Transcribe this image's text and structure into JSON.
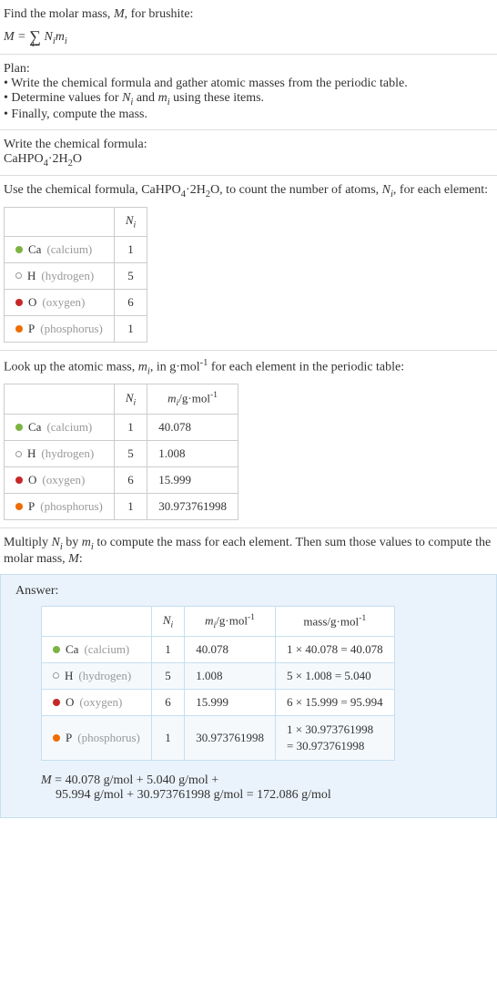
{
  "intro": {
    "line1_pre": "Find the molar mass, ",
    "line1_var": "M",
    "line1_post": ", for brushite:",
    "formula_html": "M = ∑ N<sub>i</sub>m<sub>i</sub>",
    "formula_sub": "i"
  },
  "plan": {
    "heading": "Plan:",
    "b1": "• Write the chemical formula and gather atomic masses from the periodic table.",
    "b2_pre": "• Determine values for ",
    "b2_n": "N",
    "b2_mid": " and ",
    "b2_m": "m",
    "b2_post": " using these items.",
    "b3": "• Finally, compute the mass."
  },
  "writeFormula": {
    "heading": "Write the chemical formula:",
    "formula": "CaHPO4·2H2O"
  },
  "countAtoms": {
    "heading_pre": "Use the chemical formula, CaHPO",
    "heading_mid": "·2H",
    "heading_post": "O, to count the number of atoms, ",
    "heading_var": "N",
    "heading_end": ", for each element:",
    "col_n": "N",
    "rows": [
      {
        "sym": "Ca",
        "name": "(calcium)",
        "dot": "dot-ca",
        "n": "1"
      },
      {
        "sym": "H",
        "name": "(hydrogen)",
        "dot": "dot-h",
        "n": "5"
      },
      {
        "sym": "O",
        "name": "(oxygen)",
        "dot": "dot-o",
        "n": "6"
      },
      {
        "sym": "P",
        "name": "(phosphorus)",
        "dot": "dot-p",
        "n": "1"
      }
    ]
  },
  "atomicMass": {
    "heading_pre": "Look up the atomic mass, ",
    "heading_var": "m",
    "heading_mid": ", in g·mol",
    "heading_post": " for each element in the periodic table:",
    "col_n": "N",
    "col_m": "m",
    "col_m_unit": "/g·mol",
    "rows": [
      {
        "sym": "Ca",
        "name": "(calcium)",
        "dot": "dot-ca",
        "n": "1",
        "m": "40.078"
      },
      {
        "sym": "H",
        "name": "(hydrogen)",
        "dot": "dot-h",
        "n": "5",
        "m": "1.008"
      },
      {
        "sym": "O",
        "name": "(oxygen)",
        "dot": "dot-o",
        "n": "6",
        "m": "15.999"
      },
      {
        "sym": "P",
        "name": "(phosphorus)",
        "dot": "dot-p",
        "n": "1",
        "m": "30.973761998"
      }
    ]
  },
  "multiply": {
    "heading_pre": "Multiply ",
    "heading_n": "N",
    "heading_mid": " by ",
    "heading_m": "m",
    "heading_post": " to compute the mass for each element. Then sum those values to compute the molar mass, ",
    "heading_M": "M",
    "heading_end": ":"
  },
  "answer": {
    "label": "Answer:",
    "col_n": "N",
    "col_m": "m",
    "col_m_unit": "/g·mol",
    "col_mass": "mass/g·mol",
    "rows": [
      {
        "sym": "Ca",
        "name": "(calcium)",
        "dot": "dot-ca",
        "n": "1",
        "m": "40.078",
        "mass": "1 × 40.078 = 40.078"
      },
      {
        "sym": "H",
        "name": "(hydrogen)",
        "dot": "dot-h",
        "n": "5",
        "m": "1.008",
        "mass": "5 × 1.008 = 5.040"
      },
      {
        "sym": "O",
        "name": "(oxygen)",
        "dot": "dot-o",
        "n": "6",
        "m": "15.999",
        "mass": "6 × 15.999 = 95.994"
      },
      {
        "sym": "P",
        "name": "(phosphorus)",
        "dot": "dot-p",
        "n": "1",
        "m": "30.973761998",
        "mass1": "1 × 30.973761998",
        "mass2": "= 30.973761998"
      }
    ],
    "final_line1": "M = 40.078 g/mol + 5.040 g/mol +",
    "final_line2": "95.994 g/mol + 30.973761998 g/mol = 172.086 g/mol"
  },
  "chart_data": {
    "type": "table",
    "title": "Molar mass calculation for brushite (CaHPO4·2H2O)",
    "elements": [
      {
        "element": "Ca",
        "name": "calcium",
        "N_i": 1,
        "m_i_g_per_mol": 40.078,
        "mass_g_per_mol": 40.078
      },
      {
        "element": "H",
        "name": "hydrogen",
        "N_i": 5,
        "m_i_g_per_mol": 1.008,
        "mass_g_per_mol": 5.04
      },
      {
        "element": "O",
        "name": "oxygen",
        "N_i": 6,
        "m_i_g_per_mol": 15.999,
        "mass_g_per_mol": 95.994
      },
      {
        "element": "P",
        "name": "phosphorus",
        "N_i": 1,
        "m_i_g_per_mol": 30.973761998,
        "mass_g_per_mol": 30.973761998
      }
    ],
    "molar_mass_g_per_mol": 172.086
  }
}
